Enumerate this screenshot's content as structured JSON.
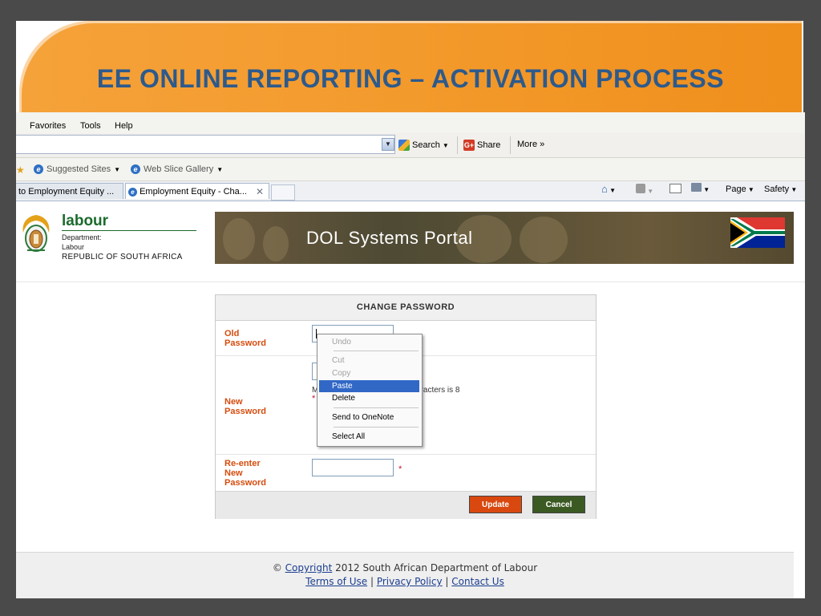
{
  "slide": {
    "title": "EE ONLINE REPORTING – ACTIVATION PROCESS"
  },
  "browser": {
    "menu": [
      "Favorites",
      "Tools",
      "Help"
    ],
    "toolbar": {
      "search_label": "Search",
      "share_label": "Share",
      "more_label": "More »"
    },
    "favorites_bar": {
      "items": [
        "Suggested Sites",
        "Web Slice Gallery"
      ]
    },
    "tabs": [
      {
        "label": "to Employment Equity ...",
        "active": false
      },
      {
        "label": "Employment Equity - Cha...",
        "active": true
      }
    ],
    "command_bar": {
      "page_label": "Page",
      "safety_label": "Safety"
    }
  },
  "header": {
    "brand_name": "labour",
    "dept_line1": "Department:",
    "dept_line2": "Labour",
    "country": "REPUBLIC OF SOUTH AFRICA",
    "portal_title": "DOL Systems Portal"
  },
  "change_password": {
    "heading": "CHANGE PASSWORD",
    "old_label_1": "Old",
    "old_label_2": "Password",
    "new_label_1": "New",
    "new_label_2": "Password",
    "reenter_label_1": "Re-enter",
    "reenter_label_2": "New",
    "reenter_label_3": "Password",
    "hint_visible_start": "M",
    "hint_visible_end": "aracters is 8",
    "required_marker": "*",
    "update_label": "Update",
    "cancel_label": "Cancel"
  },
  "context_menu": {
    "items": [
      "Undo",
      "Cut",
      "Copy",
      "Paste",
      "Delete",
      "Send to OneNote",
      "Select All"
    ],
    "selected": "Paste"
  },
  "footer": {
    "copyright_symbol": "©",
    "copyright_link": "Copyright",
    "copyright_text": "2012 South African Department of Labour",
    "links": [
      "Terms of Use",
      "Privacy Policy",
      "Contact Us"
    ],
    "separator": "|"
  },
  "colors": {
    "title_band": "#f39a2c",
    "title_text": "#2d5a8c",
    "label_orange": "#d64c0e",
    "update_button": "#d9480f",
    "cancel_button": "#3b5a23",
    "menu_highlight": "#3168c6",
    "brand_green": "#1b6b2c"
  }
}
